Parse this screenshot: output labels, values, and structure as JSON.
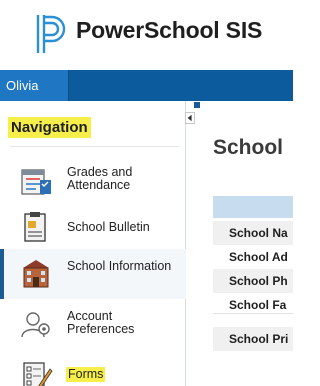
{
  "app": {
    "brand": "PowerSchool SIS",
    "accent": "#0b5b9d",
    "highlight": "#f6ef4a"
  },
  "topbar": {
    "user_tab": "Olivia"
  },
  "sidebar": {
    "title": "Navigation",
    "items": [
      {
        "label": "Grades and Attendance",
        "icon": "grades-attendance-icon"
      },
      {
        "label": "School Bulletin",
        "icon": "bulletin-icon"
      },
      {
        "label": "School Information",
        "icon": "school-building-icon",
        "active": true
      },
      {
        "label": "Account Preferences",
        "icon": "account-preferences-icon"
      },
      {
        "label": "Forms",
        "icon": "forms-icon",
        "highlighted": true
      }
    ]
  },
  "main": {
    "title": "School",
    "rows": [
      "School Na",
      "School Ad",
      "School Ph",
      "School Fa",
      "School Pri"
    ]
  }
}
